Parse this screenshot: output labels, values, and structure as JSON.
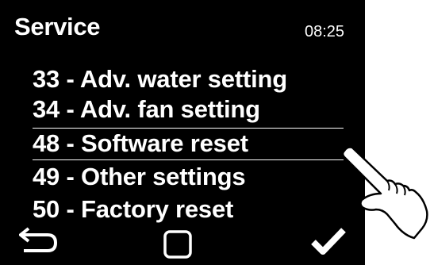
{
  "header": {
    "title": "Service",
    "time": "08:25"
  },
  "menu": {
    "items": [
      {
        "label": "33 - Adv. water setting"
      },
      {
        "label": "34 - Adv. fan setting"
      },
      {
        "label": "48 - Software reset",
        "selected": true
      },
      {
        "label": "49 - Other settings"
      },
      {
        "label": "50 - Factory reset"
      }
    ]
  },
  "footer": {
    "icons": [
      "back-arrow-icon",
      "home-square-icon",
      "checkmark-icon"
    ]
  },
  "overlay": {
    "icon": "pointing-hand-icon"
  },
  "colors": {
    "screen_background": "#000000",
    "text": "#ffffff",
    "page_background": "#ffffff"
  }
}
